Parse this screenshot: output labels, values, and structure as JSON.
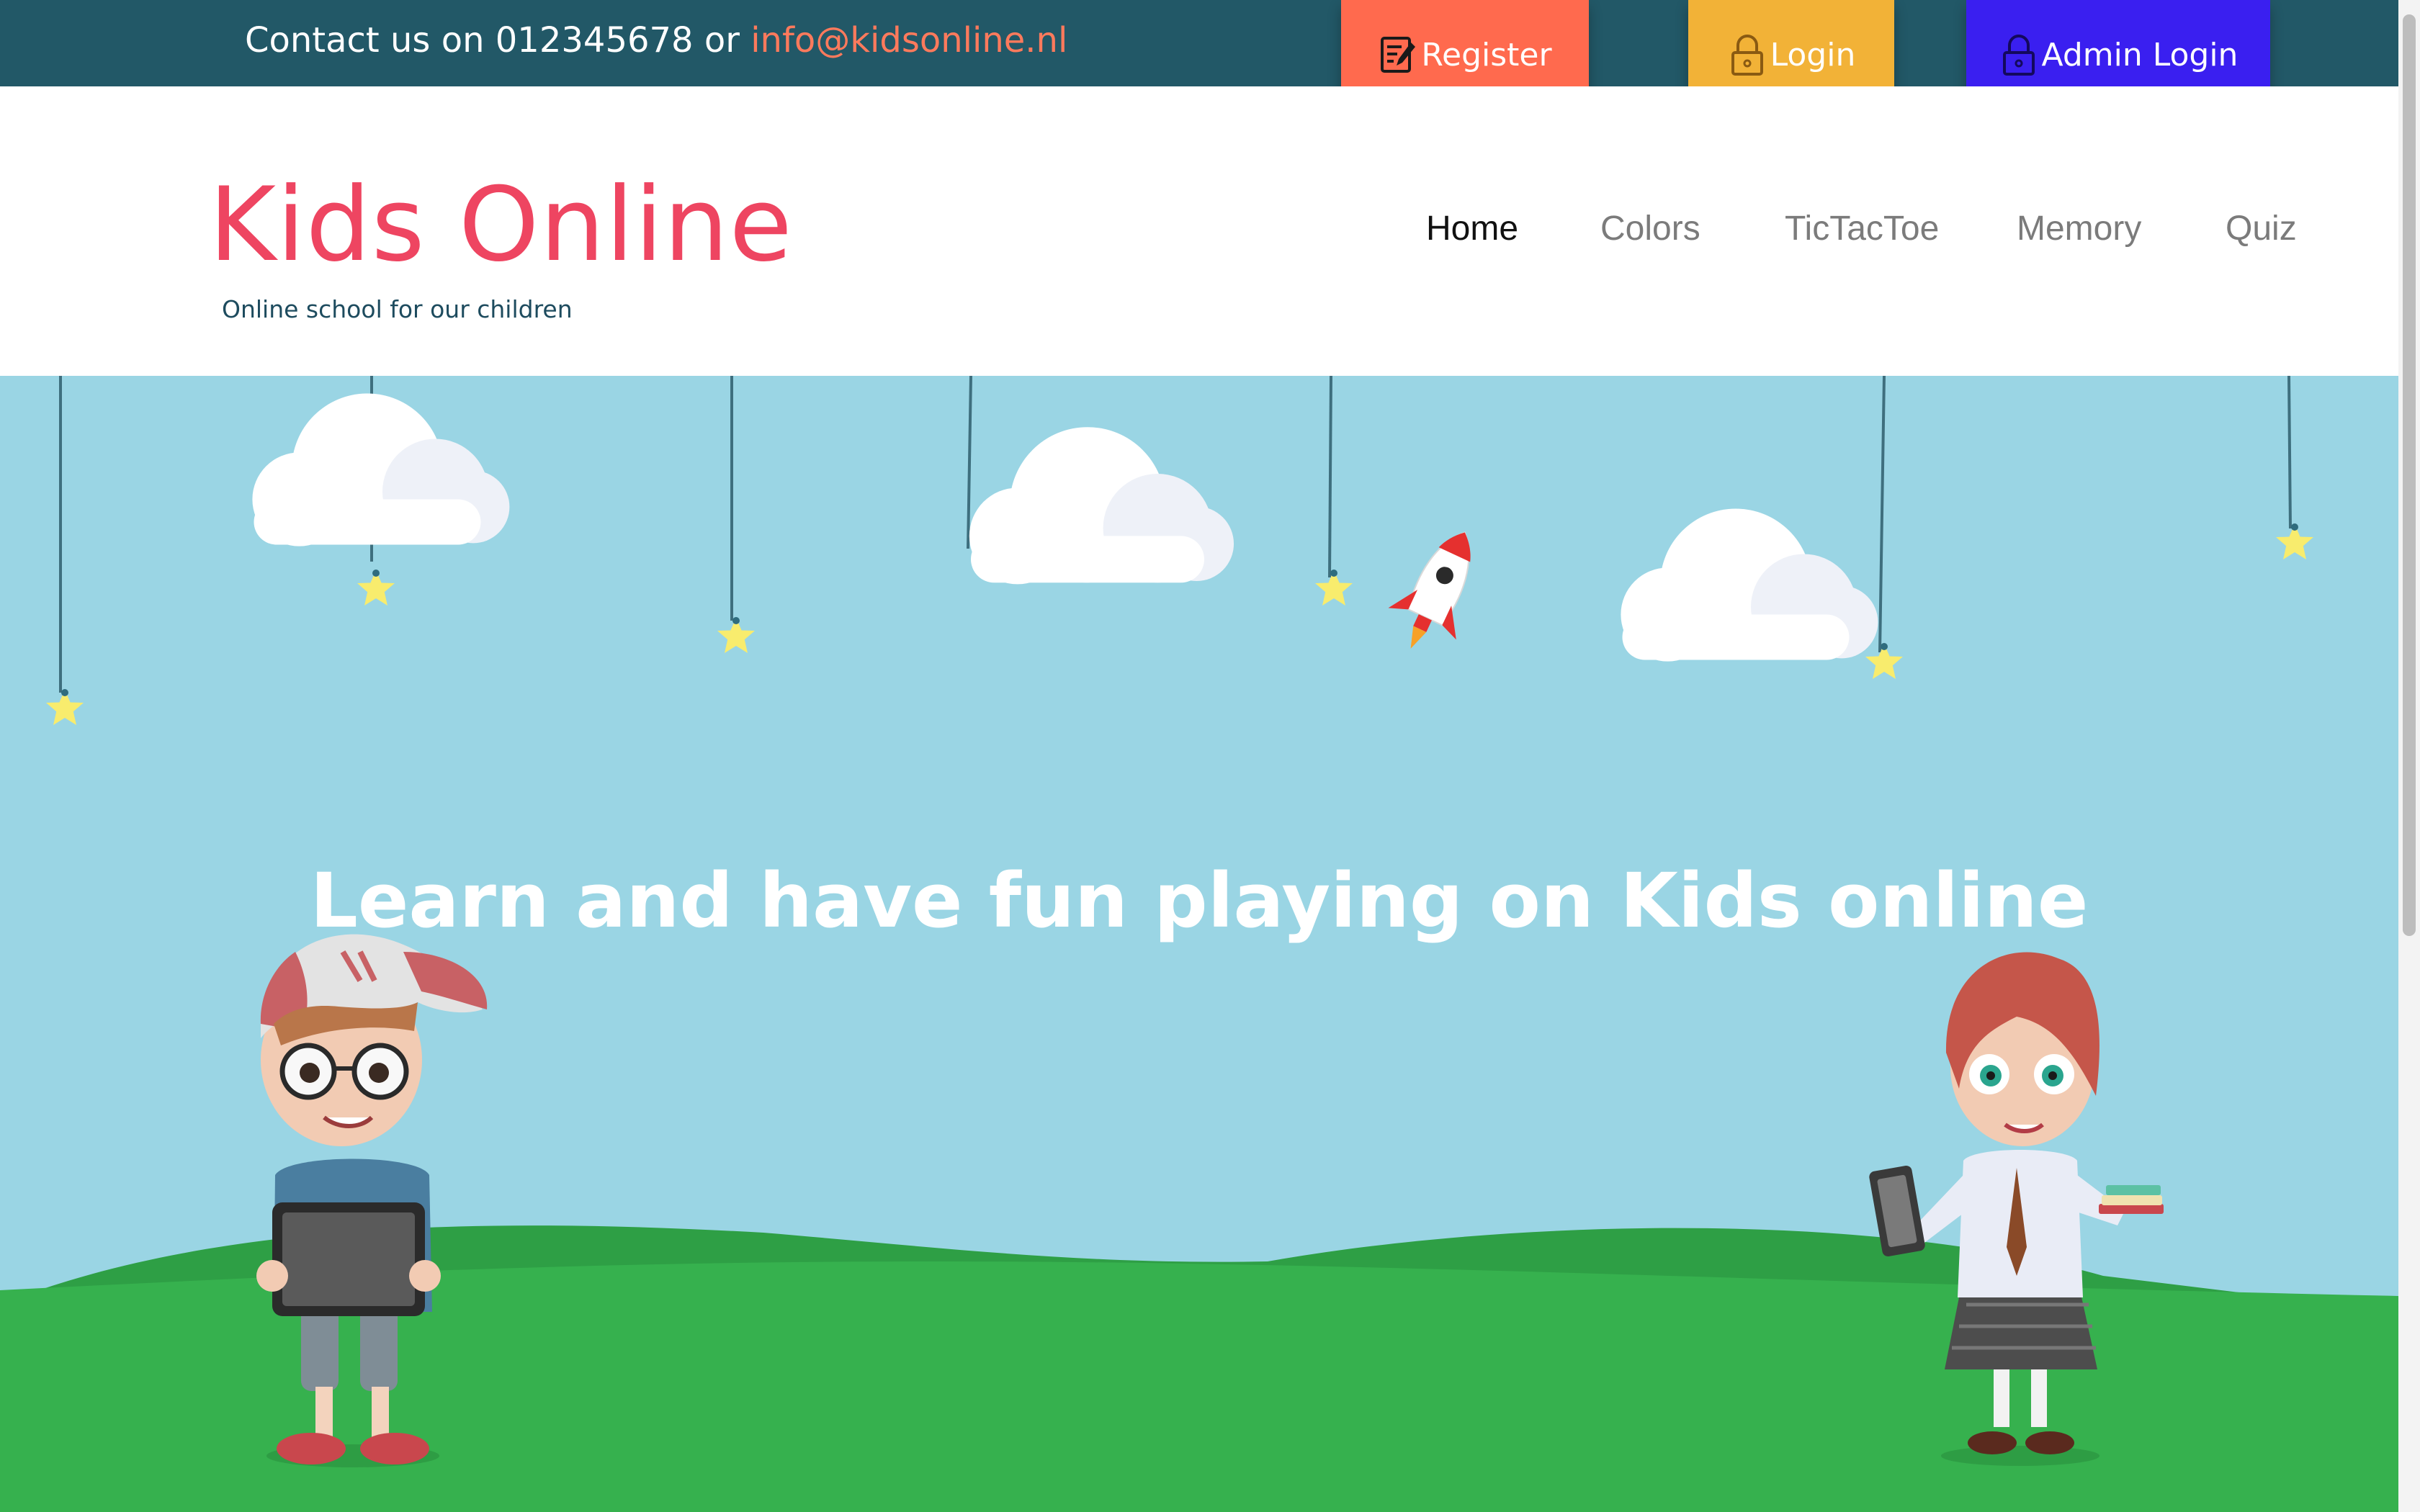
{
  "topbar": {
    "contact_prefix": "Contact us on 012345678 or ",
    "contact_email": "info@kidsonline.nl",
    "register_label": "Register",
    "login_label": "Login",
    "admin_login_label": "Admin Login"
  },
  "brand": {
    "logo": "Kids Online",
    "tagline": "Online school for our children"
  },
  "nav": {
    "items": [
      {
        "label": "Home",
        "active": true
      },
      {
        "label": "Colors"
      },
      {
        "label": "TicTacToe"
      },
      {
        "label": "Memory"
      },
      {
        "label": "Quiz"
      }
    ]
  },
  "hero": {
    "title": "Learn and have fun playing on Kids online"
  },
  "colors": {
    "topbar": "#225867",
    "register": "#ff6a4e",
    "login": "#f2b237",
    "admin_login": "#3a1ff0",
    "logo": "#ee4561",
    "sky": "#9ad5e4",
    "grass": "#36b14e"
  },
  "icons": {
    "register": "edit-note-icon",
    "login": "lock-icon",
    "admin_login": "lock-icon"
  }
}
